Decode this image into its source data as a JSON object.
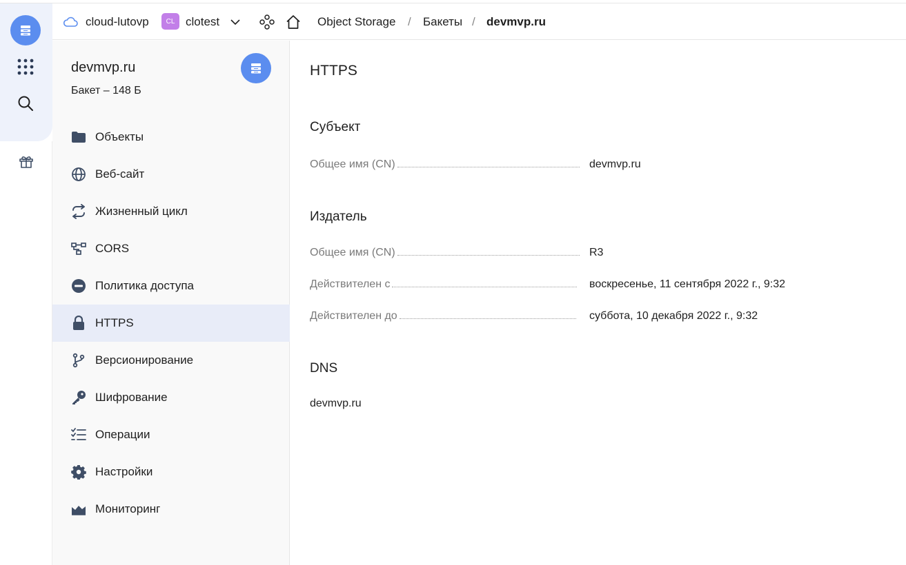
{
  "header": {
    "cloud_name": "cloud-lutovp",
    "folder_badge": "CL",
    "folder_name": "clotest",
    "breadcrumbs": [
      "Object Storage",
      "Бакеты",
      "devmvp.ru"
    ],
    "separator": "/"
  },
  "sidebar": {
    "title": "devmvp.ru",
    "subtitle": "Бакет – 148 Б",
    "items": [
      {
        "label": "Объекты",
        "icon": "folder-icon"
      },
      {
        "label": "Веб-сайт",
        "icon": "globe-icon"
      },
      {
        "label": "Жизненный цикл",
        "icon": "cycle-icon"
      },
      {
        "label": "CORS",
        "icon": "cors-icon"
      },
      {
        "label": "Политика доступа",
        "icon": "no-entry-icon"
      },
      {
        "label": "HTTPS",
        "icon": "lock-icon",
        "active": true
      },
      {
        "label": "Версионирование",
        "icon": "branch-icon"
      },
      {
        "label": "Шифрование",
        "icon": "key-icon"
      },
      {
        "label": "Операции",
        "icon": "checklist-icon"
      },
      {
        "label": "Настройки",
        "icon": "gear-icon"
      },
      {
        "label": "Мониторинг",
        "icon": "chart-icon"
      }
    ]
  },
  "main": {
    "title": "HTTPS",
    "subject": {
      "title": "Субъект",
      "rows": [
        {
          "key": "Общее имя (CN)",
          "value": "devmvp.ru"
        }
      ]
    },
    "issuer": {
      "title": "Издатель",
      "rows": [
        {
          "key": "Общее имя (CN)",
          "value": "R3"
        },
        {
          "key": "Действителен с",
          "value": "воскресенье, 11 сентября 2022 г., 9:32"
        },
        {
          "key": "Действителен до",
          "value": "суббота, 10 декабря 2022 г., 9:32"
        }
      ]
    },
    "dns": {
      "title": "DNS",
      "value": "devmvp.ru"
    }
  },
  "colors": {
    "accent": "#5b8def",
    "active_bg": "#e8ecf8",
    "icon": "#3f4e66",
    "folder_badge": "#c27fe8"
  }
}
